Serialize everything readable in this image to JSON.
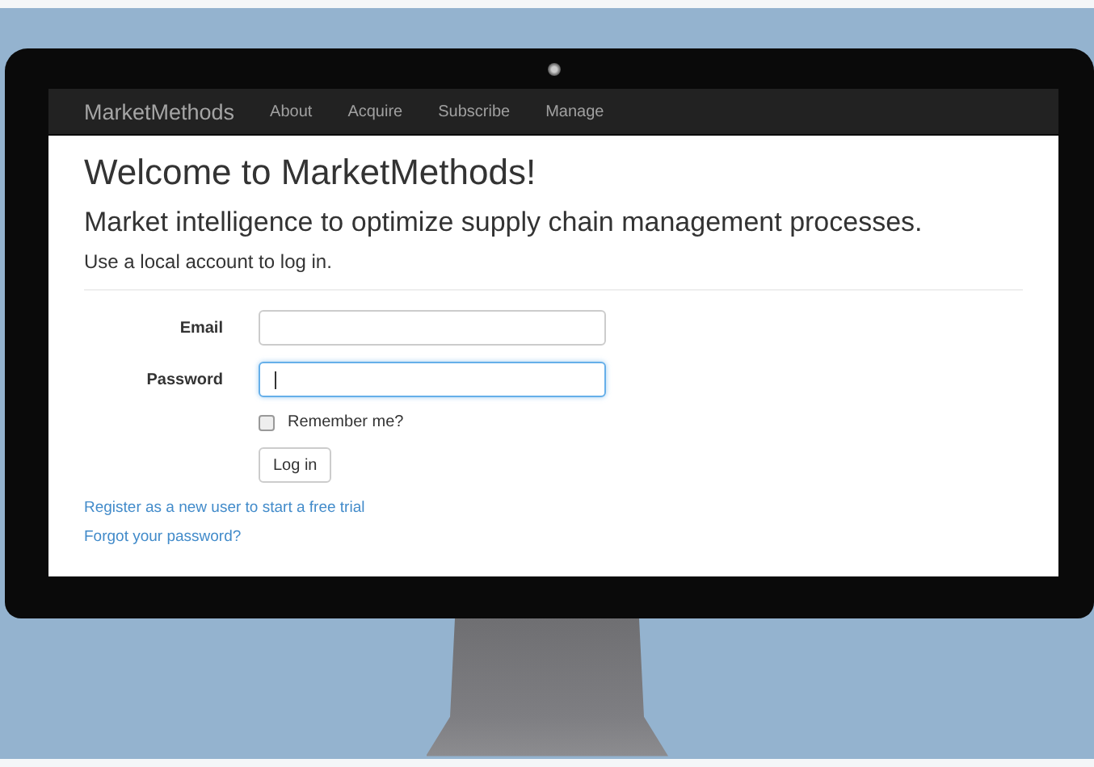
{
  "navbar": {
    "brand": "MarketMethods",
    "links": [
      {
        "label": "About"
      },
      {
        "label": "Acquire"
      },
      {
        "label": "Subscribe"
      },
      {
        "label": "Manage"
      }
    ]
  },
  "heading": "Welcome to MarketMethods!",
  "subheading": "Market intelligence to optimize supply chain management processes.",
  "instruction": "Use a local account to log in.",
  "form": {
    "fields": [
      {
        "label": "Email",
        "focused": false
      },
      {
        "label": "Password",
        "focused": true
      }
    ],
    "remember": {
      "label": "Remember me?",
      "checked": false
    },
    "submit": "Log in"
  },
  "links": [
    "Register as a new user to start a free trial",
    "Forgot your password?"
  ]
}
